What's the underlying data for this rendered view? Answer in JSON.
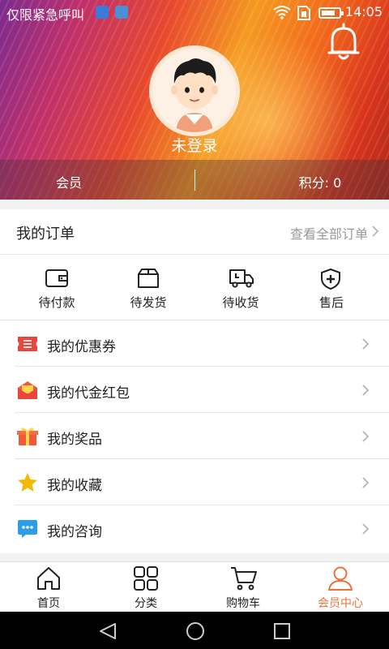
{
  "status_bar": {
    "notification_text": "仅限紧急呼叫",
    "time": "14:05"
  },
  "profile": {
    "username": "未登录",
    "member_label": "会员",
    "points_label": "积分: 0"
  },
  "orders": {
    "title": "我的订单",
    "view_all": "查看全部订单",
    "items": [
      {
        "label": "待付款",
        "icon": "wallet-icon"
      },
      {
        "label": "待发货",
        "icon": "package-icon"
      },
      {
        "label": "待收货",
        "icon": "delivery-truck-icon"
      },
      {
        "label": "售后",
        "icon": "shield-plus-icon"
      }
    ]
  },
  "menu": {
    "items": [
      {
        "label": "我的优惠券",
        "icon": "coupon-icon"
      },
      {
        "label": "我的代金红包",
        "icon": "red-envelope-icon"
      },
      {
        "label": "我的奖品",
        "icon": "gift-icon"
      },
      {
        "label": "我的收藏",
        "icon": "star-icon"
      },
      {
        "label": "我的咨询",
        "icon": "chat-bubble-icon"
      }
    ]
  },
  "tab_bar": {
    "tabs": [
      {
        "label": "首页",
        "icon": "home-icon"
      },
      {
        "label": "分类",
        "icon": "category-grid-icon"
      },
      {
        "label": "购物车",
        "icon": "cart-icon"
      },
      {
        "label": "会员中心",
        "icon": "user-icon"
      }
    ],
    "active_index": 3
  },
  "colors": {
    "accent": "#f0703a",
    "coupon": "#e9463c",
    "gift": "#ef5a38",
    "star": "#f5b800",
    "chat": "#2a9ee8"
  }
}
